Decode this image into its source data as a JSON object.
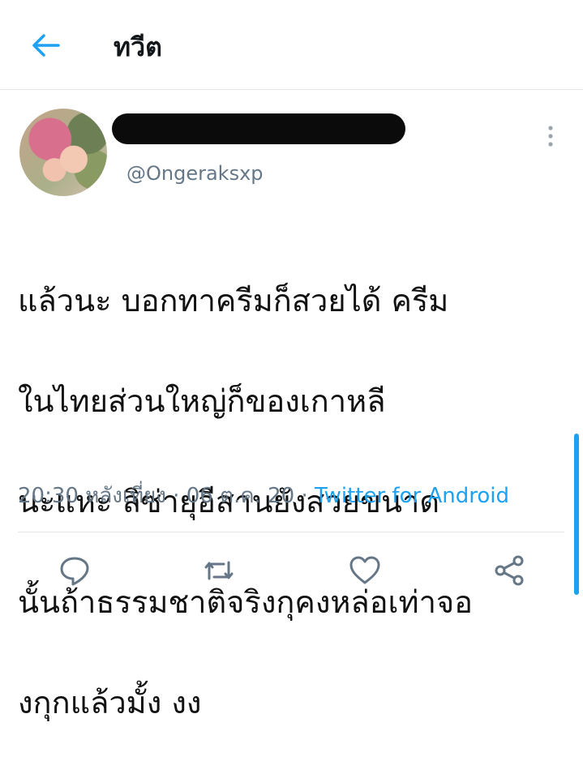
{
  "header": {
    "title": "ทวีต",
    "back_icon": "arrow-left-icon"
  },
  "colors": {
    "accent": "#1da1f2",
    "secondary_text": "#657786",
    "divider": "#e1e5e8"
  },
  "tweet": {
    "handle": "@Ongeraksxp",
    "text_lines": [
      "แล้วนะ บอกทาครีมก็สวยได้ ครีม",
      "ในไทยส่วนใหญ่ก็ของเกาหลี",
      "นะแหะ ลิซ่ายุอีสานยังสวยขนาด",
      "นั้นถ้าธรรมชาติจริงกุคงหล่อเท่าจอ",
      "งกุกแล้วมั้ง งง"
    ],
    "time": "20:30 หลังเที่ยง",
    "separator1": " · ",
    "date": "06 ต.ค. 20",
    "separator2": " · ",
    "source": "Twitter for Android"
  },
  "actions": [
    "reply-icon",
    "retweet-icon",
    "like-icon",
    "share-icon"
  ]
}
